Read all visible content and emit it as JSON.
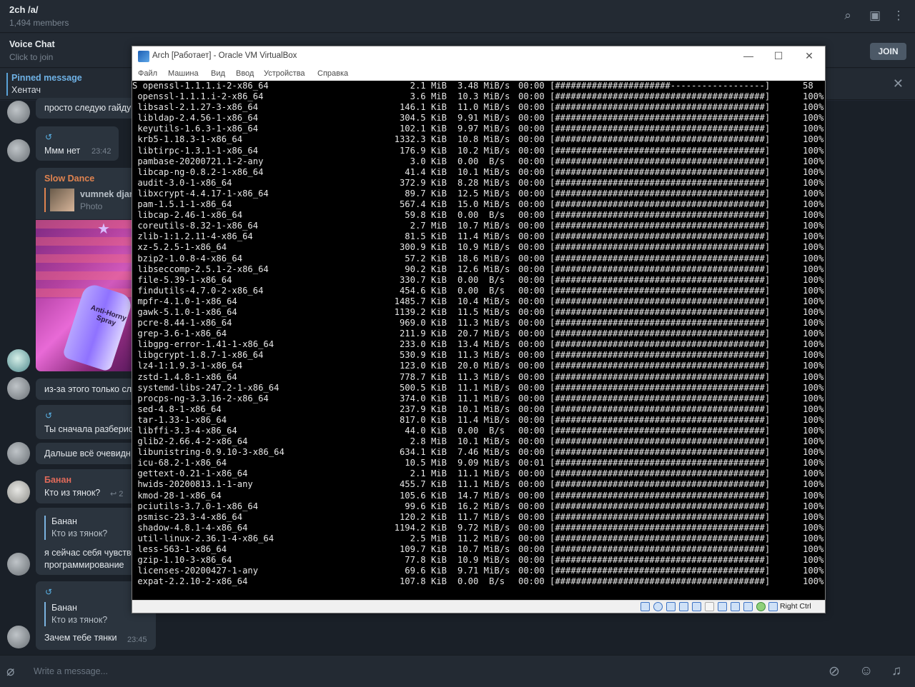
{
  "telegram": {
    "header": {
      "title": "2ch /a/",
      "subtitle": "1,494 members"
    },
    "voice_chat": {
      "title": "Voice Chat",
      "subtitle": "Click to join",
      "join_label": "JOIN"
    },
    "pinned": {
      "title": "Pinned message",
      "text": "Хентач"
    },
    "messages": [
      {
        "text": "просто следую гайду"
      },
      {
        "reply_icon": "↺",
        "text": "Ммм нет",
        "time": "23:42"
      },
      {
        "name": "Slow Dance",
        "fwd_name": "vumnek djan",
        "fwd_sub": "Photo"
      },
      {
        "text": "из-за этого только сл"
      },
      {
        "reply_icon": "↺",
        "text": "Ты сначала разберис"
      },
      {
        "text": "Дальше всё очевидн"
      },
      {
        "name": "Банан",
        "text": "Кто из тянок?",
        "time": "2"
      },
      {
        "reply_name": "Банан",
        "reply_text": "Кто из тянок?",
        "text_1": "я сейчас себя чувств",
        "text_2": "программирование"
      },
      {
        "reply_icon": "↺",
        "reply_name": "Банан",
        "reply_text": "Кто из тянок?",
        "text": "Зачем тебе тянки",
        "time": "23:45"
      }
    ],
    "photo_label": "Anti-Horny Spray",
    "composer": {
      "placeholder": "Write a message..."
    },
    "colors": {
      "accent": "#5aa2d8",
      "name_orange": "#e0834f",
      "name_red": "#e06a5a"
    }
  },
  "vbox": {
    "title": "Arch [Работает] - Oracle VM VirtualBox",
    "menu": [
      "Файл",
      "Машина",
      "Вид",
      "Ввод",
      "Устройства",
      "Справка"
    ],
    "host_key": "Right Ctrl",
    "terminal_rows": [
      {
        "name": "S openssl-1.1.1.i-2-x86_64",
        "size": "2.1 MiB",
        "speed": "3.48 MiB/s",
        "time": "00:00",
        "bar": "[######################------------------]",
        "pct": "58"
      },
      {
        "name": " openssl-1.1.1.i-2-x86_64",
        "size": "3.6 MiB",
        "speed": "10.3 MiB/s",
        "time": "00:00",
        "bar": "[########################################]",
        "pct": "100%"
      },
      {
        "name": " libsasl-2.1.27-3-x86_64",
        "size": "146.1 KiB",
        "speed": "11.0 MiB/s",
        "time": "00:00",
        "bar": "[########################################]",
        "pct": "100%"
      },
      {
        "name": " libldap-2.4.56-1-x86_64",
        "size": "304.5 KiB",
        "speed": "9.91 MiB/s",
        "time": "00:00",
        "bar": "[########################################]",
        "pct": "100%"
      },
      {
        "name": " keyutils-1.6.3-1-x86_64",
        "size": "102.1 KiB",
        "speed": "9.97 MiB/s",
        "time": "00:00",
        "bar": "[########################################]",
        "pct": "100%"
      },
      {
        "name": " krb5-1.18.3-1-x86_64",
        "size": "1332.3 KiB",
        "speed": "10.8 MiB/s",
        "time": "00:00",
        "bar": "[########################################]",
        "pct": "100%"
      },
      {
        "name": " libtirpc-1.3.1-1-x86_64",
        "size": "176.9 KiB",
        "speed": "10.2 MiB/s",
        "time": "00:00",
        "bar": "[########################################]",
        "pct": "100%"
      },
      {
        "name": " pambase-20200721.1-2-any",
        "size": "3.0 KiB",
        "speed": "0.00  B/s",
        "time": "00:00",
        "bar": "[########################################]",
        "pct": "100%"
      },
      {
        "name": " libcap-ng-0.8.2-1-x86_64",
        "size": "41.4 KiB",
        "speed": "10.1 MiB/s",
        "time": "00:00",
        "bar": "[########################################]",
        "pct": "100%"
      },
      {
        "name": " audit-3.0-1-x86_64",
        "size": "372.9 KiB",
        "speed": "8.28 MiB/s",
        "time": "00:00",
        "bar": "[########################################]",
        "pct": "100%"
      },
      {
        "name": " libxcrypt-4.4.17-1-x86_64",
        "size": "89.7 KiB",
        "speed": "12.5 MiB/s",
        "time": "00:00",
        "bar": "[########################################]",
        "pct": "100%"
      },
      {
        "name": " pam-1.5.1-1-x86_64",
        "size": "567.4 KiB",
        "speed": "15.0 MiB/s",
        "time": "00:00",
        "bar": "[########################################]",
        "pct": "100%"
      },
      {
        "name": " libcap-2.46-1-x86_64",
        "size": "59.8 KiB",
        "speed": "0.00  B/s",
        "time": "00:00",
        "bar": "[########################################]",
        "pct": "100%"
      },
      {
        "name": " coreutils-8.32-1-x86_64",
        "size": "2.7 MiB",
        "speed": "10.7 MiB/s",
        "time": "00:00",
        "bar": "[########################################]",
        "pct": "100%"
      },
      {
        "name": " zlib-1:1.2.11-4-x86_64",
        "size": "81.5 KiB",
        "speed": "11.4 MiB/s",
        "time": "00:00",
        "bar": "[########################################]",
        "pct": "100%"
      },
      {
        "name": " xz-5.2.5-1-x86_64",
        "size": "300.9 KiB",
        "speed": "10.9 MiB/s",
        "time": "00:00",
        "bar": "[########################################]",
        "pct": "100%"
      },
      {
        "name": " bzip2-1.0.8-4-x86_64",
        "size": "57.2 KiB",
        "speed": "18.6 MiB/s",
        "time": "00:00",
        "bar": "[########################################]",
        "pct": "100%"
      },
      {
        "name": " libseccomp-2.5.1-2-x86_64",
        "size": "90.2 KiB",
        "speed": "12.6 MiB/s",
        "time": "00:00",
        "bar": "[########################################]",
        "pct": "100%"
      },
      {
        "name": " file-5.39-1-x86_64",
        "size": "330.7 KiB",
        "speed": "0.00  B/s",
        "time": "00:00",
        "bar": "[########################################]",
        "pct": "100%"
      },
      {
        "name": " findutils-4.7.0-2-x86_64",
        "size": "454.6 KiB",
        "speed": "0.00  B/s",
        "time": "00:00",
        "bar": "[########################################]",
        "pct": "100%"
      },
      {
        "name": " mpfr-4.1.0-1-x86_64",
        "size": "1485.7 KiB",
        "speed": "10.4 MiB/s",
        "time": "00:00",
        "bar": "[########################################]",
        "pct": "100%"
      },
      {
        "name": " gawk-5.1.0-1-x86_64",
        "size": "1139.2 KiB",
        "speed": "11.5 MiB/s",
        "time": "00:00",
        "bar": "[########################################]",
        "pct": "100%"
      },
      {
        "name": " pcre-8.44-1-x86_64",
        "size": "969.0 KiB",
        "speed": "11.3 MiB/s",
        "time": "00:00",
        "bar": "[########################################]",
        "pct": "100%"
      },
      {
        "name": " grep-3.6-1-x86_64",
        "size": "211.9 KiB",
        "speed": "20.7 MiB/s",
        "time": "00:00",
        "bar": "[########################################]",
        "pct": "100%"
      },
      {
        "name": " libgpg-error-1.41-1-x86_64",
        "size": "233.0 KiB",
        "speed": "13.4 MiB/s",
        "time": "00:00",
        "bar": "[########################################]",
        "pct": "100%"
      },
      {
        "name": " libgcrypt-1.8.7-1-x86_64",
        "size": "530.9 KiB",
        "speed": "11.3 MiB/s",
        "time": "00:00",
        "bar": "[########################################]",
        "pct": "100%"
      },
      {
        "name": " lz4-1:1.9.3-1-x86_64",
        "size": "123.0 KiB",
        "speed": "20.0 MiB/s",
        "time": "00:00",
        "bar": "[########################################]",
        "pct": "100%"
      },
      {
        "name": " zstd-1.4.8-1-x86_64",
        "size": "778.7 KiB",
        "speed": "11.3 MiB/s",
        "time": "00:00",
        "bar": "[########################################]",
        "pct": "100%"
      },
      {
        "name": " systemd-libs-247.2-1-x86_64",
        "size": "500.5 KiB",
        "speed": "11.1 MiB/s",
        "time": "00:00",
        "bar": "[########################################]",
        "pct": "100%"
      },
      {
        "name": " procps-ng-3.3.16-2-x86_64",
        "size": "374.0 KiB",
        "speed": "11.1 MiB/s",
        "time": "00:00",
        "bar": "[########################################]",
        "pct": "100%"
      },
      {
        "name": " sed-4.8-1-x86_64",
        "size": "237.9 KiB",
        "speed": "10.1 MiB/s",
        "time": "00:00",
        "bar": "[########################################]",
        "pct": "100%"
      },
      {
        "name": " tar-1.33-1-x86_64",
        "size": "817.0 KiB",
        "speed": "11.4 MiB/s",
        "time": "00:00",
        "bar": "[########################################]",
        "pct": "100%"
      },
      {
        "name": " libffi-3.3-4-x86_64",
        "size": "44.0 KiB",
        "speed": "0.00  B/s",
        "time": "00:00",
        "bar": "[########################################]",
        "pct": "100%"
      },
      {
        "name": " glib2-2.66.4-2-x86_64",
        "size": "2.8 MiB",
        "speed": "10.1 MiB/s",
        "time": "00:00",
        "bar": "[########################################]",
        "pct": "100%"
      },
      {
        "name": " libunistring-0.9.10-3-x86_64",
        "size": "634.1 KiB",
        "speed": "7.46 MiB/s",
        "time": "00:00",
        "bar": "[########################################]",
        "pct": "100%"
      },
      {
        "name": " icu-68.2-1-x86_64",
        "size": "10.5 MiB",
        "speed": "9.09 MiB/s",
        "time": "00:01",
        "bar": "[########################################]",
        "pct": "100%"
      },
      {
        "name": " gettext-0.21-1-x86_64",
        "size": "2.1 MiB",
        "speed": "11.1 MiB/s",
        "time": "00:00",
        "bar": "[########################################]",
        "pct": "100%"
      },
      {
        "name": " hwids-20200813.1-1-any",
        "size": "455.7 KiB",
        "speed": "11.1 MiB/s",
        "time": "00:00",
        "bar": "[########################################]",
        "pct": "100%"
      },
      {
        "name": " kmod-28-1-x86_64",
        "size": "105.6 KiB",
        "speed": "14.7 MiB/s",
        "time": "00:00",
        "bar": "[########################################]",
        "pct": "100%"
      },
      {
        "name": " pciutils-3.7.0-1-x86_64",
        "size": "99.6 KiB",
        "speed": "16.2 MiB/s",
        "time": "00:00",
        "bar": "[########################################]",
        "pct": "100%"
      },
      {
        "name": " psmisc-23.3-4-x86_64",
        "size": "120.2 KiB",
        "speed": "11.7 MiB/s",
        "time": "00:00",
        "bar": "[########################################]",
        "pct": "100%"
      },
      {
        "name": " shadow-4.8.1-4-x86_64",
        "size": "1194.2 KiB",
        "speed": "9.72 MiB/s",
        "time": "00:00",
        "bar": "[########################################]",
        "pct": "100%"
      },
      {
        "name": " util-linux-2.36.1-4-x86_64",
        "size": "2.5 MiB",
        "speed": "11.2 MiB/s",
        "time": "00:00",
        "bar": "[########################################]",
        "pct": "100%"
      },
      {
        "name": " less-563-1-x86_64",
        "size": "109.7 KiB",
        "speed": "10.7 MiB/s",
        "time": "00:00",
        "bar": "[########################################]",
        "pct": "100%"
      },
      {
        "name": " gzip-1.10-3-x86_64",
        "size": "77.8 KiB",
        "speed": "10.9 MiB/s",
        "time": "00:00",
        "bar": "[########################################]",
        "pct": "100%"
      },
      {
        "name": " licenses-20200427-1-any",
        "size": "69.6 KiB",
        "speed": "9.71 MiB/s",
        "time": "00:00",
        "bar": "[########################################]",
        "pct": "100%"
      },
      {
        "name": " expat-2.2.10-2-x86_64",
        "size": "107.8 KiB",
        "speed": "0.00  B/s",
        "time": "00:00",
        "bar": "[########################################]",
        "pct": "100%"
      }
    ]
  }
}
